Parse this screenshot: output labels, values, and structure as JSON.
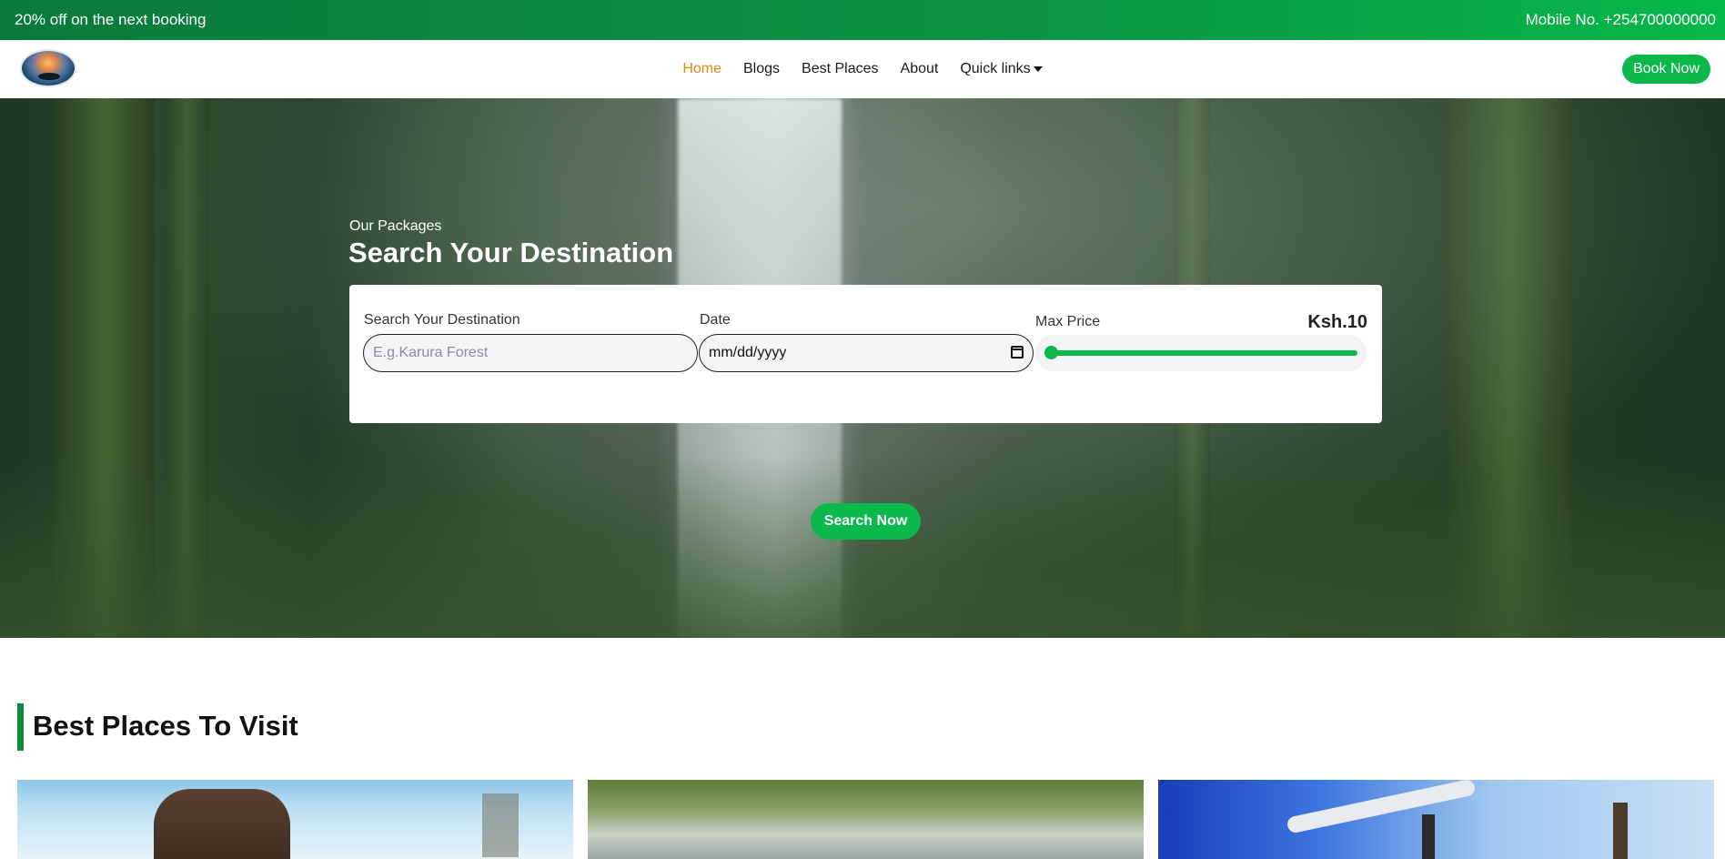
{
  "topbar": {
    "promo": "20% off on the next booking",
    "mobile": "Mobile No. +254700000000"
  },
  "navbar": {
    "logo_icon": "island-sunset-logo",
    "links": [
      {
        "label": "Home",
        "active": true
      },
      {
        "label": "Blogs",
        "active": false
      },
      {
        "label": "Best Places",
        "active": false
      },
      {
        "label": "About",
        "active": false
      },
      {
        "label": "Quick links",
        "active": false,
        "dropdown": true
      }
    ],
    "book_now": "Book Now",
    "active_color": "#d98a1a"
  },
  "hero": {
    "subtitle": "Our Packages",
    "title": "Search Your Destination",
    "search": {
      "destination_label": "Search Your Destination",
      "destination_placeholder": "E.g.Karura Forest",
      "date_label": "Date",
      "date_placeholder": "mm/dd/yyyy",
      "max_price_label": "Max Price",
      "max_price_value": "Ksh.10",
      "slider_fraction": 0.0,
      "button": "Search Now"
    }
  },
  "section": {
    "title": "Best Places To Visit"
  },
  "colors": {
    "brand_green": "#0bb84c",
    "topbar_green": "#0a7a3c"
  }
}
